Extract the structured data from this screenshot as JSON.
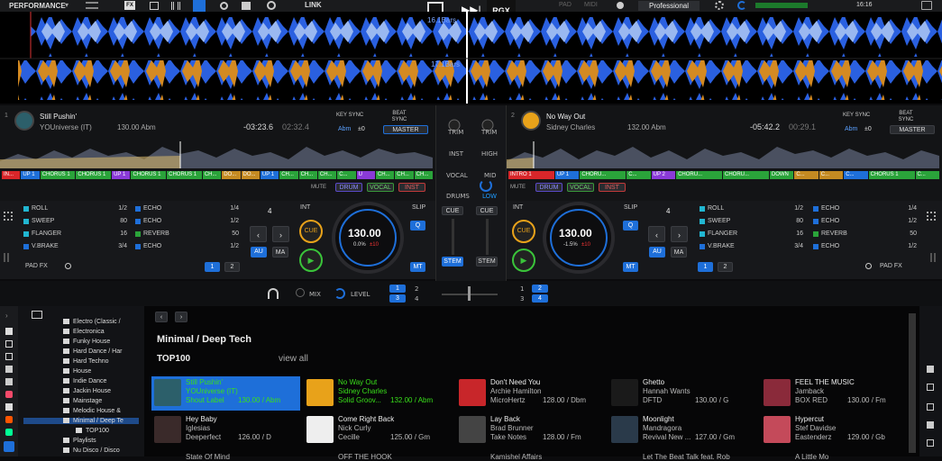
{
  "topbar": {
    "mode": "PERFORMANCE",
    "link": "LINK",
    "rgx": "RGX",
    "pad": "PAD",
    "midi": "MIDI",
    "profile": "Professional",
    "clock": "16:16"
  },
  "waveform": {
    "bars_a": "16.1Bars",
    "bars_b": "17.1Bars"
  },
  "deck_left": {
    "number": "1",
    "title": "Still Pushin'",
    "artist": "YOUniverse (IT)",
    "bpm_key": "130.00 Abm",
    "remain": "-03:23.6",
    "elapsed": "02:32.4",
    "key_sync": "KEY SYNC",
    "beat_sync": "BEAT SYNC",
    "key": "Abm",
    "key_offset": "±0",
    "master": "MASTER",
    "segments": [
      "IN...",
      "UP 1",
      "CHORUS 1",
      "CHORUS 1",
      "UP 1",
      "CHORUS 1",
      "CHORUS 1",
      "CH...",
      "DO...",
      "DO...",
      "UP 1",
      "CH...",
      "CH...",
      "CH...",
      "C...",
      "U",
      "CH...",
      "CH...",
      "CH..."
    ],
    "stem_mute": "MUTE",
    "stem_drum": "DRUM",
    "stem_vocal": "VOCAL",
    "stem_inst": "INST",
    "fx": [
      {
        "name": "ROLL",
        "val": "1/2"
      },
      {
        "name": "SWEEP",
        "val": "80"
      },
      {
        "name": "FLANGER",
        "val": "16"
      },
      {
        "name": "V.BRAKE",
        "val": "3/4"
      }
    ],
    "fx2": [
      {
        "name": "ECHO",
        "val": "1/4"
      },
      {
        "name": "ECHO",
        "val": "1/2"
      },
      {
        "name": "REVERB",
        "val": "50"
      },
      {
        "name": "ECHO",
        "val": "1/2"
      }
    ],
    "loop": "4",
    "int": "INT",
    "cue": "CUE",
    "au": "AU",
    "ma": "MA",
    "slip": "SLIP",
    "q": "Q",
    "mt": "MT",
    "bpm": "130.00",
    "pitch": "0.0%",
    "pitch_range": "±10",
    "pad_fx": "PAD FX",
    "page1": "1",
    "page2": "2"
  },
  "deck_right": {
    "number": "2",
    "title": "No Way Out",
    "artist": "Sidney Charles",
    "bpm_key": "132.00 Abm",
    "remain": "-05:42.2",
    "elapsed": "00:29.1",
    "key_sync": "KEY SYNC",
    "beat_sync": "BEAT SYNC",
    "key": "Abm",
    "key_offset": "±0",
    "master": "MASTER",
    "segments": [
      "INTRO 1",
      "UP 1",
      "CHORU...",
      "C...",
      "UP 2",
      "CHORU...",
      "CHORU...",
      "DOWN",
      "C...",
      "C...",
      "C...",
      "CHORUS 1",
      "C..."
    ],
    "stem_mute": "MUTE",
    "stem_drum": "DRUM",
    "stem_vocal": "VOCAL",
    "stem_inst": "INST",
    "fx": [
      {
        "name": "ROLL",
        "val": "1/2"
      },
      {
        "name": "SWEEP",
        "val": "80"
      },
      {
        "name": "FLANGER",
        "val": "16"
      },
      {
        "name": "V.BRAKE",
        "val": "3/4"
      }
    ],
    "fx2": [
      {
        "name": "ECHO",
        "val": "1/4"
      },
      {
        "name": "ECHO",
        "val": "1/2"
      },
      {
        "name": "REVERB",
        "val": "50"
      },
      {
        "name": "ECHO",
        "val": "1/2"
      }
    ],
    "loop": "4",
    "int": "INT",
    "cue": "CUE",
    "au": "AU",
    "ma": "MA",
    "slip": "SLIP",
    "q": "Q",
    "mt": "MT",
    "bpm": "130.00",
    "pitch": "-1.5%",
    "pitch_range": "±10",
    "pad_fx": "PAD FX",
    "page1": "1",
    "page2": "2"
  },
  "mixer": {
    "trim": "TRIM",
    "inst": "INST",
    "high": "HIGH",
    "vocal": "VOCAL",
    "mid": "MID",
    "drums": "DRUMS",
    "low": "LOW",
    "cue": "CUE",
    "stem": "STEM",
    "mix": "MIX",
    "level": "LEVEL",
    "n1": "1",
    "n2": "2",
    "n3": "3",
    "n4": "4"
  },
  "browser": {
    "tree": [
      "Electro (Classic /",
      "Electronica",
      "Funky House",
      "Hard Dance / Har",
      "Hard Techno",
      "House",
      "Indie Dance",
      "Jackin House",
      "Mainstage",
      "Melodic House &",
      "Minimal / Deep Te",
      "TOP100",
      "Playlists",
      "Nu Disco / Disco"
    ],
    "heading": "Minimal / Deep Tech",
    "top100": "TOP100",
    "view_all": "view all",
    "tracks": [
      {
        "title": "Still Pushin'",
        "artist": "YOUniverse (IT)",
        "label": "Shout Label",
        "info": "130.00 / Abm",
        "state": "loaded",
        "art": "#2c5f6a"
      },
      {
        "title": "No Way Out",
        "artist": "Sidney Charles",
        "label": "Solid Groov...",
        "info": "132.00 / Abm",
        "state": "deck2",
        "art": "#e8a21a"
      },
      {
        "title": "Don't Need You",
        "artist": "Archie Hamilton",
        "label": "MicroHertz",
        "info": "128.00 / Dbm",
        "state": "",
        "art": "#c8262a"
      },
      {
        "title": "Ghetto",
        "artist": "Hannah Wants",
        "label": "DFTD",
        "info": "130.00 / G",
        "state": "",
        "art": "#1a1a1a"
      },
      {
        "title": "FEEL THE MUSIC",
        "artist": "Jamback",
        "label": "BOX RED",
        "info": "130.00 / Fm",
        "state": "",
        "art": "#8a2a3a"
      },
      {
        "title": "Hey Baby",
        "artist": "Iglesias",
        "label": "Deeperfect",
        "info": "126.00 / D",
        "state": "",
        "art": "#3a2a2a"
      },
      {
        "title": "Come Right Back",
        "artist": "Nick Curly",
        "label": "Cecille",
        "info": "125.00 / Gm",
        "state": "",
        "art": "#eeeeee"
      },
      {
        "title": "Lay Back",
        "artist": "Brad Brunner",
        "label": "Take Notes",
        "info": "128.00 / Fm",
        "state": "",
        "art": "#444444"
      },
      {
        "title": "Moonlight",
        "artist": "Mandragora",
        "label": "Revival New ...",
        "info": "127.00 / Gm",
        "state": "",
        "art": "#2a3a4a"
      },
      {
        "title": "Hypercut",
        "artist": "Stef Davidse",
        "label": "Eastenderz",
        "info": "129.00 / Gb",
        "state": "",
        "art": "#c44a5a"
      }
    ],
    "next_row": [
      "State Of Mind",
      "OFF THE HOOK",
      "Kamishel Affairs",
      "Let The Beat Talk feat. Rob",
      "A Little Mo"
    ]
  },
  "colors": {
    "accent": "#1e6fd9",
    "loaded_tile": "#1e6fd9",
    "deck2_text": "#39e01a",
    "wave_blue": "#2a60e0",
    "wave_orange": "#d48a22"
  }
}
